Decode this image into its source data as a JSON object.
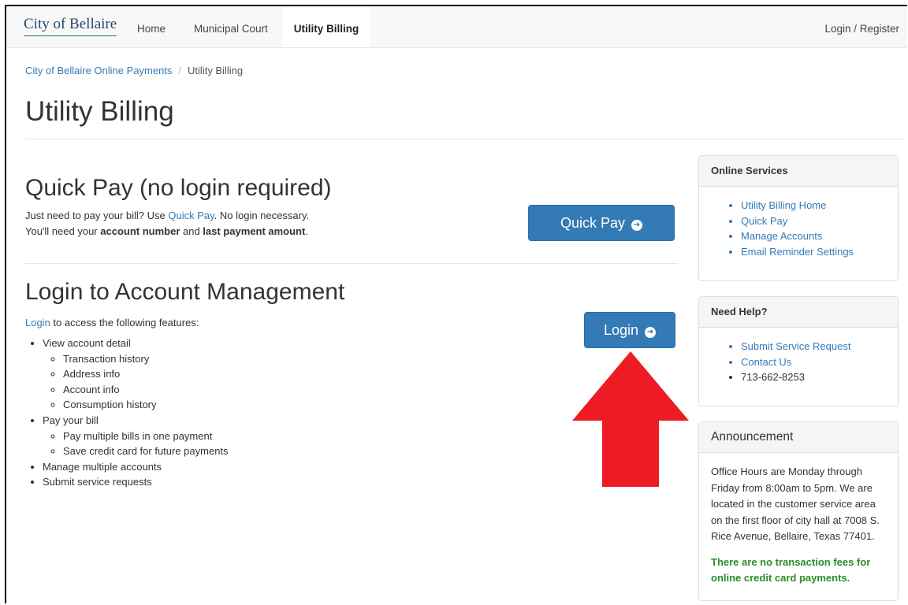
{
  "nav": {
    "brand": "City of Bellaire",
    "items": [
      "Home",
      "Municipal Court",
      "Utility Billing"
    ],
    "login": "Login / Register"
  },
  "breadcrumb": {
    "root": "City of Bellaire Online Payments",
    "current": "Utility Billing"
  },
  "page_title": "Utility Billing",
  "quick_pay": {
    "heading": "Quick Pay (no login required)",
    "line1_pre": "Just need to pay your bill? Use ",
    "line1_link": "Quick Pay",
    "line1_post": ". No login necessary.",
    "line2_pre": "You'll need your ",
    "line2_bold1": "account number",
    "line2_mid": " and ",
    "line2_bold2": "last payment amount",
    "line2_post": ".",
    "button": "Quick Pay"
  },
  "login_section": {
    "heading": "Login to Account Management",
    "intro_link": "Login",
    "intro_text": " to access the following features:",
    "button": "Login",
    "features": [
      {
        "label": "View account detail",
        "sub": [
          "Transaction history",
          "Address info",
          "Account info",
          "Consumption history"
        ]
      },
      {
        "label": "Pay your bill",
        "sub": [
          "Pay multiple bills in one payment",
          "Save credit card for future payments"
        ]
      },
      {
        "label": "Manage multiple accounts",
        "sub": []
      },
      {
        "label": "Submit service requests",
        "sub": []
      }
    ]
  },
  "online_services": {
    "title": "Online Services",
    "links": [
      "Utility Billing Home",
      "Quick Pay",
      "Manage Accounts",
      "Email Reminder Settings"
    ]
  },
  "need_help": {
    "title": "Need Help?",
    "links": [
      "Submit Service Request",
      "Contact Us"
    ],
    "phone": "713-662-8253"
  },
  "announcement": {
    "title": "Announcement",
    "text": "Office Hours are Monday through Friday from 8:00am to 5pm. We are located in the customer service area on the first floor of city hall at 7008 S. Rice Avenue, Bellaire, Texas 77401.",
    "note": "There are no transaction fees for online credit card payments."
  },
  "colors": {
    "link": "#337ab7",
    "button": "#337ab7",
    "arrow": "#ed1c24",
    "note": "#2a8c2a"
  },
  "icons": {
    "button_icon": "circle-arrow-right-icon",
    "annotation": "red-arrow-up-icon"
  }
}
